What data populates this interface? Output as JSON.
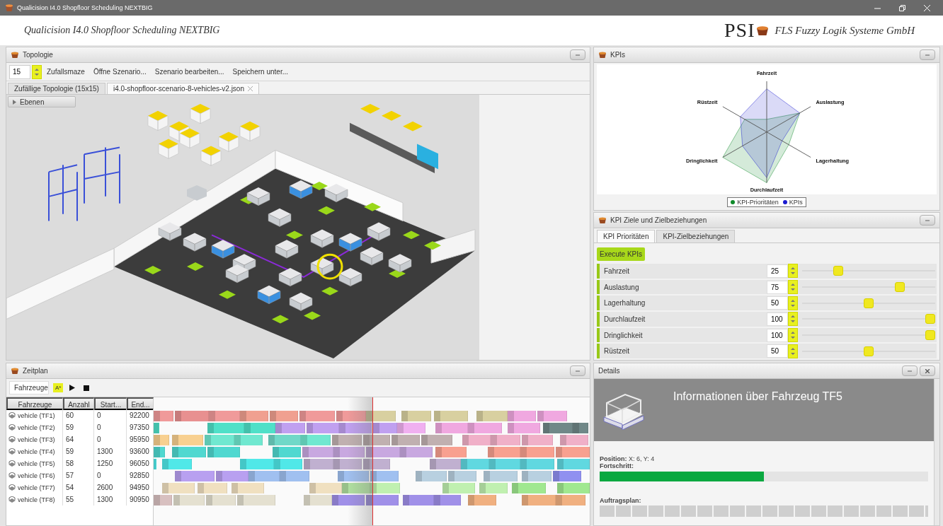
{
  "window": {
    "title": "Qualicision I4.0 Shopfloor Scheduling NEXTBIG"
  },
  "header": {
    "app_title": "Qualicision I4.0 Shopfloor Scheduling NEXTBIG",
    "logo_text": "PSI",
    "company": "FLS Fuzzy Logik Systeme GmbH"
  },
  "topology": {
    "title": "Topologie",
    "size_value": "15",
    "toolbar": [
      "Zufallsmaze",
      "Öffne Szenario...",
      "Szenario bearbeiten...",
      "Speichern unter..."
    ],
    "tabs": [
      {
        "label": "Zufällige Topologie (15x15)",
        "selected": false,
        "closable": false
      },
      {
        "label": "i4.0-shopfloor-scenario-8-vehicles-v2.json",
        "selected": true,
        "closable": true
      }
    ],
    "layers_button": "Ebenen"
  },
  "kpis": {
    "title": "KPIs",
    "axes": [
      "Fahrzeit",
      "Auslastung",
      "Lagerhaltung",
      "Durchlaufzeit",
      "Dringlichkeit",
      "Rüstzeit"
    ],
    "legend": [
      {
        "label": "KPI-Prioritäten",
        "color": "#0f8a2a"
      },
      {
        "label": "KPIs",
        "color": "#1a1ad0"
      }
    ]
  },
  "kpi_goals": {
    "title": "KPI Ziele und Zielbeziehungen",
    "tabs": [
      {
        "label": "KPI Prioritäten",
        "selected": true
      },
      {
        "label": "KPI-Zielbeziehungen",
        "selected": false
      }
    ],
    "execute_button": "Execute KPIs",
    "sliders": [
      {
        "name": "Fahrzeit",
        "value": "25",
        "level": 0.25
      },
      {
        "name": "Auslastung",
        "value": "75",
        "level": 0.75
      },
      {
        "name": "Lagerhaltung",
        "value": "50",
        "level": 0.5
      },
      {
        "name": "Durchlaufzeit",
        "value": "100",
        "level": 1
      },
      {
        "name": "Dringlichkeit",
        "value": "100",
        "level": 1
      },
      {
        "name": "Rüstzeit",
        "value": "50",
        "level": 0.5
      }
    ]
  },
  "schedule": {
    "title": "Zeitplan",
    "filter": "Fahrzeuge",
    "algorithm_button": "A*",
    "columns": [
      "Fahrzeuge",
      "Anzahl",
      "Start...",
      "End..."
    ],
    "rows": [
      {
        "vehicle": "vehicle (TF1)",
        "count": "60",
        "start": "0",
        "end": "92200"
      },
      {
        "vehicle": "vehicle (TF2)",
        "count": "59",
        "start": "0",
        "end": "97350"
      },
      {
        "vehicle": "vehicle (TF3)",
        "count": "64",
        "start": "0",
        "end": "95950"
      },
      {
        "vehicle": "vehicle (TF4)",
        "count": "59",
        "start": "1300",
        "end": "93600"
      },
      {
        "vehicle": "vehicle (TF5)",
        "count": "58",
        "start": "1250",
        "end": "96050"
      },
      {
        "vehicle": "vehicle (TF6)",
        "count": "57",
        "start": "0",
        "end": "92850"
      },
      {
        "vehicle": "vehicle (TF7)",
        "count": "54",
        "start": "2600",
        "end": "94950"
      },
      {
        "vehicle": "vehicle (TF8)",
        "count": "55",
        "start": "1300",
        "end": "90950"
      }
    ]
  },
  "details": {
    "title": "Details",
    "heading": "Informationen über Fahrzeug TF5",
    "position": "**Position:** X: 6, Y: 4",
    "progress_label": "Fortschritt:",
    "progress": {
      "level": 0.5
    },
    "plan_label": "Auftragsplan:"
  }
}
